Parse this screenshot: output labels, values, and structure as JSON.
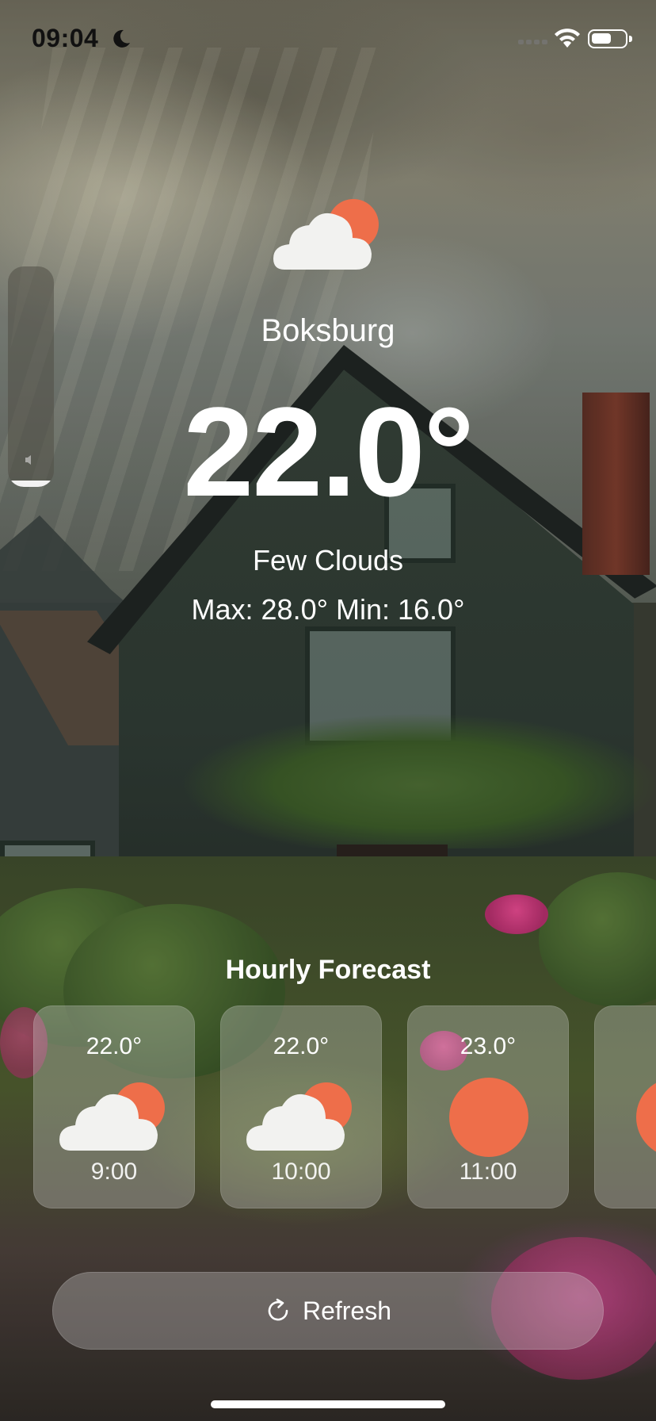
{
  "status_bar": {
    "time": "09:04",
    "icons": [
      "moon-icon",
      "cellular-signal-icon",
      "wifi-icon",
      "battery-icon"
    ],
    "battery_level": 0.6
  },
  "volume_hud": {
    "level": 0.03,
    "icon": "speaker-icon"
  },
  "weather": {
    "icon": "few-clouds-icon",
    "city": "Boksburg",
    "temperature": "22.0°",
    "condition": "Few Clouds",
    "max_min": "Max: 28.0° Min: 16.0°"
  },
  "hourly": {
    "title": "Hourly Forecast",
    "items": [
      {
        "temp": "22.0°",
        "time": "9:00",
        "icon": "few-clouds-icon"
      },
      {
        "temp": "22.0°",
        "time": "10:00",
        "icon": "few-clouds-icon"
      },
      {
        "temp": "23.0°",
        "time": "11:00",
        "icon": "sun-icon"
      },
      {
        "temp": "",
        "time": "",
        "icon": "sun-icon"
      }
    ]
  },
  "refresh": {
    "label": "Refresh",
    "icon": "refresh-icon"
  },
  "colors": {
    "sun": "#EE6E4A",
    "cloud": "#F2F2F0",
    "card": "rgba(210,210,210,0.32)"
  }
}
